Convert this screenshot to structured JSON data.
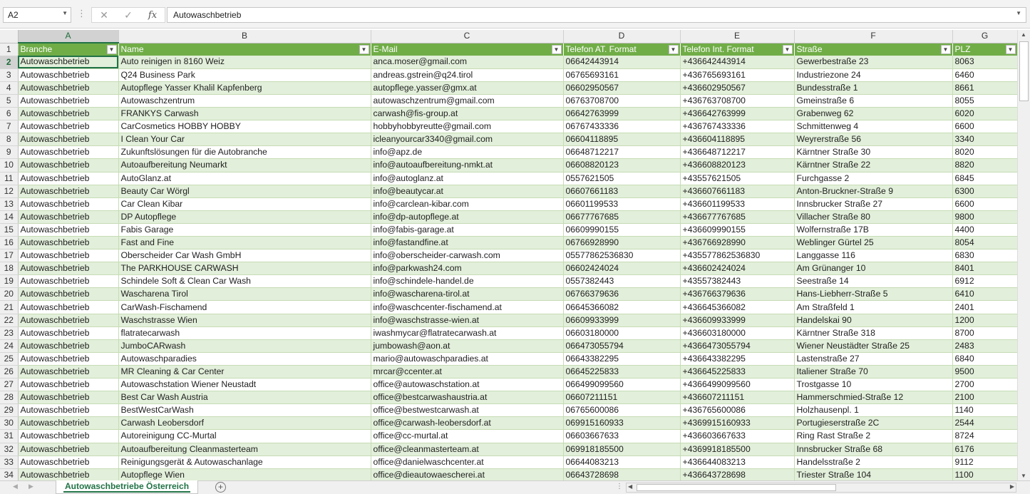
{
  "formula_bar": {
    "name_box": "A2",
    "formula": "Autowaschbetrieb",
    "cancel_glyph": "✕",
    "enter_glyph": "✓",
    "fx_label": "fx"
  },
  "columns": [
    "A",
    "B",
    "C",
    "D",
    "E",
    "F",
    "G"
  ],
  "headers": [
    "Branche",
    "Name",
    "E-Mail",
    "Telefon AT. Format",
    "Telefon Int. Format",
    "Straße",
    "PLZ"
  ],
  "rows": [
    [
      "Autowaschbetrieb",
      "Auto reinigen in 8160 Weiz",
      "anca.moser@gmail.com",
      "06642443914",
      "+436642443914",
      "Gewerbestraße 23",
      "8063"
    ],
    [
      "Autowaschbetrieb",
      "Q24 Business Park",
      "andreas.gstrein@q24.tirol",
      "06765693161",
      "+436765693161",
      "Industriezone 24",
      "6460"
    ],
    [
      "Autowaschbetrieb",
      "Autopflege Yasser Khalil Kapfenberg",
      "autopflege.yasser@gmx.at",
      "06602950567",
      "+436602950567",
      "Bundesstraße 1",
      "8661"
    ],
    [
      "Autowaschbetrieb",
      "Autowaschzentrum",
      "autowaschzentrum@gmail.com",
      "06763708700",
      "+436763708700",
      "Gmeinstraße 6",
      "8055"
    ],
    [
      "Autowaschbetrieb",
      "FRANKYS Carwash",
      "carwash@fis-group.at",
      "06642763999",
      "+436642763999",
      "Grabenweg 62",
      "6020"
    ],
    [
      "Autowaschbetrieb",
      "CarCosmetics HOBBY HOBBY",
      "hobbyhobbyreutte@gmail.com",
      "06767433336",
      "+436767433336",
      "Schmittenweg 4",
      "6600"
    ],
    [
      "Autowaschbetrieb",
      "I Clean Your Car",
      "icleanyourcar3340@gmail.com",
      "06604118895",
      "+436604118895",
      "Weyrerstraße 56",
      "3340"
    ],
    [
      "Autowaschbetrieb",
      "Zukunftslösungen für die Autobranche",
      "info@apz.de",
      "06648712217",
      "+436648712217",
      "Kärntner Straße 30",
      "8020"
    ],
    [
      "Autowaschbetrieb",
      "Autoaufbereitung Neumarkt",
      "info@autoaufbereitung-nmkt.at",
      "06608820123",
      "+436608820123",
      "Kärntner Straße 22",
      "8820"
    ],
    [
      "Autowaschbetrieb",
      "AutoGlanz.at",
      "info@autoglanz.at",
      "0557621505",
      "+43557621505",
      "Furchgasse 2",
      "6845"
    ],
    [
      "Autowaschbetrieb",
      "Beauty Car Wörgl",
      "info@beautycar.at",
      "06607661183",
      "+436607661183",
      "Anton-Bruckner-Straße 9",
      "6300"
    ],
    [
      "Autowaschbetrieb",
      "Car Clean Kibar",
      "info@carclean-kibar.com",
      "06601199533",
      "+436601199533",
      "Innsbrucker Straße 27",
      "6600"
    ],
    [
      "Autowaschbetrieb",
      "DP Autopflege",
      "info@dp-autopflege.at",
      "06677767685",
      "+436677767685",
      "Villacher Straße 80",
      "9800"
    ],
    [
      "Autowaschbetrieb",
      "Fabis Garage",
      "info@fabis-garage.at",
      "06609990155",
      "+436609990155",
      "Wolfernstraße 17B",
      "4400"
    ],
    [
      "Autowaschbetrieb",
      "Fast and Fine",
      "info@fastandfine.at",
      "06766928990",
      "+436766928990",
      "Weblinger Gürtel 25",
      "8054"
    ],
    [
      "Autowaschbetrieb",
      "Oberscheider Car Wash GmbH",
      "info@oberscheider-carwash.com",
      "05577862536830",
      "+435577862536830",
      "Langgasse 116",
      "6830"
    ],
    [
      "Autowaschbetrieb",
      "The PARKHOUSE CARWASH",
      "info@parkwash24.com",
      "06602424024",
      "+436602424024",
      "Am Grünanger 10",
      "8401"
    ],
    [
      "Autowaschbetrieb",
      "Schindele Soft & Clean Car Wash",
      "info@schindele-handel.de",
      "0557382443",
      "+43557382443",
      "Seestraße 14",
      "6912"
    ],
    [
      "Autowaschbetrieb",
      "Wascharena Tirol",
      "info@wascharena-tirol.at",
      "06766379636",
      "+436766379636",
      "Hans-Liebherr-Straße 5",
      "6410"
    ],
    [
      "Autowaschbetrieb",
      "CarWash-Fischamend",
      "info@waschcenter-fischamend.at",
      "06645366082",
      "+436645366082",
      "Am Straßfeld 1",
      "2401"
    ],
    [
      "Autowaschbetrieb",
      "Waschstrasse Wien",
      "info@waschstrasse-wien.at",
      "06609933999",
      "+436609933999",
      "Handelskai 90",
      "1200"
    ],
    [
      "Autowaschbetrieb",
      "flatratecarwash",
      "iwashmycar@flatratecarwash.at",
      "06603180000",
      "+436603180000",
      "Kärntner Straße 318",
      "8700"
    ],
    [
      "Autowaschbetrieb",
      "JumboCARwash",
      "jumbowash@aon.at",
      "066473055794",
      "+4366473055794",
      "Wiener Neustädter Straße 25",
      "2483"
    ],
    [
      "Autowaschbetrieb",
      "Autowaschparadies",
      "mario@autowaschparadies.at",
      "06643382295",
      "+436643382295",
      "Lastenstraße 27",
      "6840"
    ],
    [
      "Autowaschbetrieb",
      "MR Cleaning & Car Center",
      "mrcar@ccenter.at",
      "06645225833",
      "+436645225833",
      "Italiener Straße 70",
      "9500"
    ],
    [
      "Autowaschbetrieb",
      "Autowaschstation Wiener Neustadt",
      "office@autowaschstation.at",
      "066499099560",
      "+4366499099560",
      "Trostgasse 10",
      "2700"
    ],
    [
      "Autowaschbetrieb",
      "Best Car Wash Austria",
      "office@bestcarwashaustria.at",
      "06607211151",
      "+436607211151",
      "Hammerschmied-Straße 12",
      "2100"
    ],
    [
      "Autowaschbetrieb",
      "BestWestCarWash",
      "office@bestwestcarwash.at",
      "06765600086",
      "+436765600086",
      "Holzhausenpl. 1",
      "1140"
    ],
    [
      "Autowaschbetrieb",
      "Carwash Leobersdorf",
      "office@carwash-leobersdorf.at",
      "069915160933",
      "+4369915160933",
      "Portugieserstraße 2C",
      "2544"
    ],
    [
      "Autowaschbetrieb",
      "Autoreinigung CC-Murtal",
      "office@cc-murtal.at",
      "06603667633",
      "+436603667633",
      "Ring Rast Straße 2",
      "8724"
    ],
    [
      "Autowaschbetrieb",
      "Autoaufbereitung Cleanmasterteam",
      "office@cleanmasterteam.at",
      "069918185500",
      "+4369918185500",
      "Innsbrucker Straße 68",
      "6176"
    ],
    [
      "Autowaschbetrieb",
      "Reinigungsgerät & Autowaschanlage",
      "office@danielwaschcenter.at",
      "06644083213",
      "+436644083213",
      "Handelsstraße 2",
      "9112"
    ],
    [
      "Autowaschbetrieb",
      "Autopflege Wien",
      "office@dieautowaescherei.at",
      "06643728698",
      "+436643728698",
      "Triester Straße 104",
      "1100"
    ]
  ],
  "sheet_tab": {
    "label": "Autowaschbetriebe Österreich"
  },
  "add_sheet_glyph": "+",
  "icons": {
    "dropdown": "chevron-down-icon",
    "filter": "filter-dropdown-icon",
    "scroll_up": "triangle-up-icon",
    "scroll_down": "triangle-down-icon",
    "scroll_left": "triangle-left-icon",
    "scroll_right": "triangle-right-icon"
  },
  "colors": {
    "header_fill": "#70ad47",
    "band_fill": "#e2efda",
    "accent": "#217346"
  }
}
